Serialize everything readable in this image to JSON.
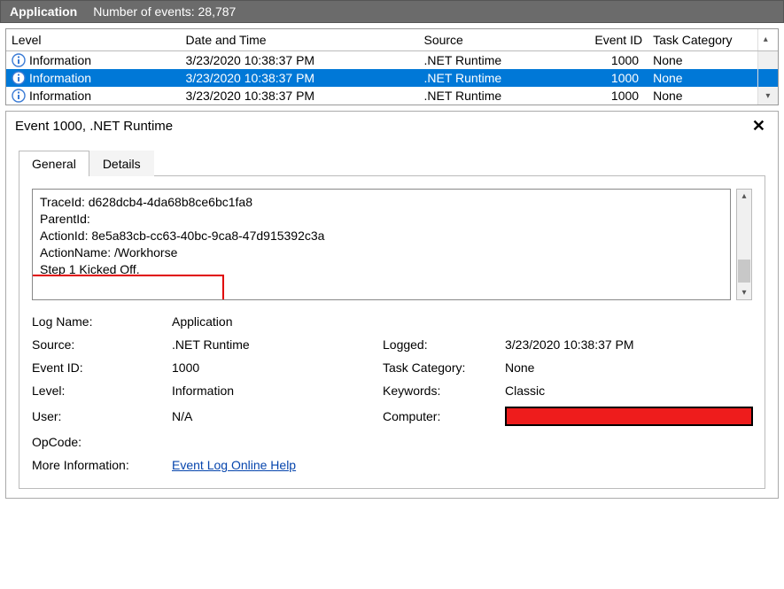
{
  "header": {
    "app_name": "Application",
    "events_count_label": "Number of events: 28,787"
  },
  "columns": {
    "level": "Level",
    "date": "Date and Time",
    "source": "Source",
    "eventid": "Event ID",
    "taskcat": "Task Category"
  },
  "rows": [
    {
      "level": "Information",
      "date": "3/23/2020 10:38:37 PM",
      "source": ".NET Runtime",
      "eventid": "1000",
      "taskcat": "None",
      "selected": false
    },
    {
      "level": "Information",
      "date": "3/23/2020 10:38:37 PM",
      "source": ".NET Runtime",
      "eventid": "1000",
      "taskcat": "None",
      "selected": true
    },
    {
      "level": "Information",
      "date": "3/23/2020 10:38:37 PM",
      "source": ".NET Runtime",
      "eventid": "1000",
      "taskcat": "None",
      "selected": false
    }
  ],
  "details": {
    "title": "Event 1000, .NET Runtime",
    "tabs": {
      "general": "General",
      "details": "Details"
    },
    "message": {
      "line1": "TraceId: d628dcb4-4da68b8ce6bc1fa8",
      "line2": "ParentId:",
      "line3": "ActionId: 8e5a83cb-cc63-40bc-9ca8-47d915392c3a",
      "line4": "ActionName: /Workhorse",
      "line5": "",
      "line6": "Step 1 Kicked Off."
    },
    "fields": {
      "log_name_label": "Log Name:",
      "log_name_value": "Application",
      "source_label": "Source:",
      "source_value": ".NET Runtime",
      "logged_label": "Logged:",
      "logged_value": "3/23/2020 10:38:37 PM",
      "eventid_label": "Event ID:",
      "eventid_value": "1000",
      "taskcat_label": "Task Category:",
      "taskcat_value": "None",
      "level_label": "Level:",
      "level_value": "Information",
      "keywords_label": "Keywords:",
      "keywords_value": "Classic",
      "user_label": "User:",
      "user_value": "N/A",
      "computer_label": "Computer:",
      "opcode_label": "OpCode:",
      "moreinfo_label": "More Information:",
      "moreinfo_link": "Event Log Online Help"
    }
  }
}
